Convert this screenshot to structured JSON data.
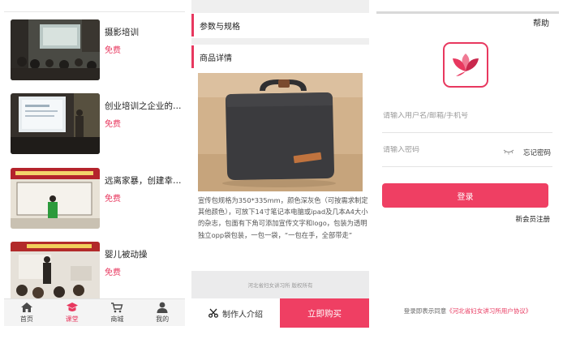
{
  "courses": [
    {
      "title": "摄影培训",
      "price": "免费"
    },
    {
      "title": "创业培训之企业的人...",
      "price": "免费"
    },
    {
      "title": "远离家暴，创建幸福...",
      "price": "免费"
    },
    {
      "title": "婴儿被动操",
      "price": "免费"
    }
  ],
  "tabbar": [
    {
      "label": "首页",
      "icon": "home-icon"
    },
    {
      "label": "课堂",
      "icon": "classroom-icon"
    },
    {
      "label": "商城",
      "icon": "cart-icon"
    },
    {
      "label": "我的",
      "icon": "user-icon"
    }
  ],
  "active_tab": "课堂",
  "product": {
    "section_spec": "参数与规格",
    "section_detail": "商品详情",
    "description": "宣传包规格为350*335mm，颜色深灰色（可按需求制定其他颜色），可放下14寸笔记本电脑或ipad及几本A4大小的杂志，包面有下角可添加宣传文字和logo，包装为透明独立opp袋包装，一包一袋，“一包在手，全部带走”",
    "footer": "河北省妇女讲习所 版权所有",
    "creator_label": "制作人介绍",
    "buy_label": "立即购买"
  },
  "login": {
    "help": "帮助",
    "username_placeholder": "请输入用户名/邮箱/手机号",
    "password_placeholder": "请输入密码",
    "forgot": "忘记密码",
    "login_button": "登录",
    "register": "新会员注册",
    "agreement_prefix": "登录即表示同意",
    "agreement_link": "《河北省妇女讲习所用户协议》"
  },
  "colors": {
    "accent": "#ef3f63",
    "tab_bg": "#f4f4f4",
    "gray_band": "#efefef"
  }
}
